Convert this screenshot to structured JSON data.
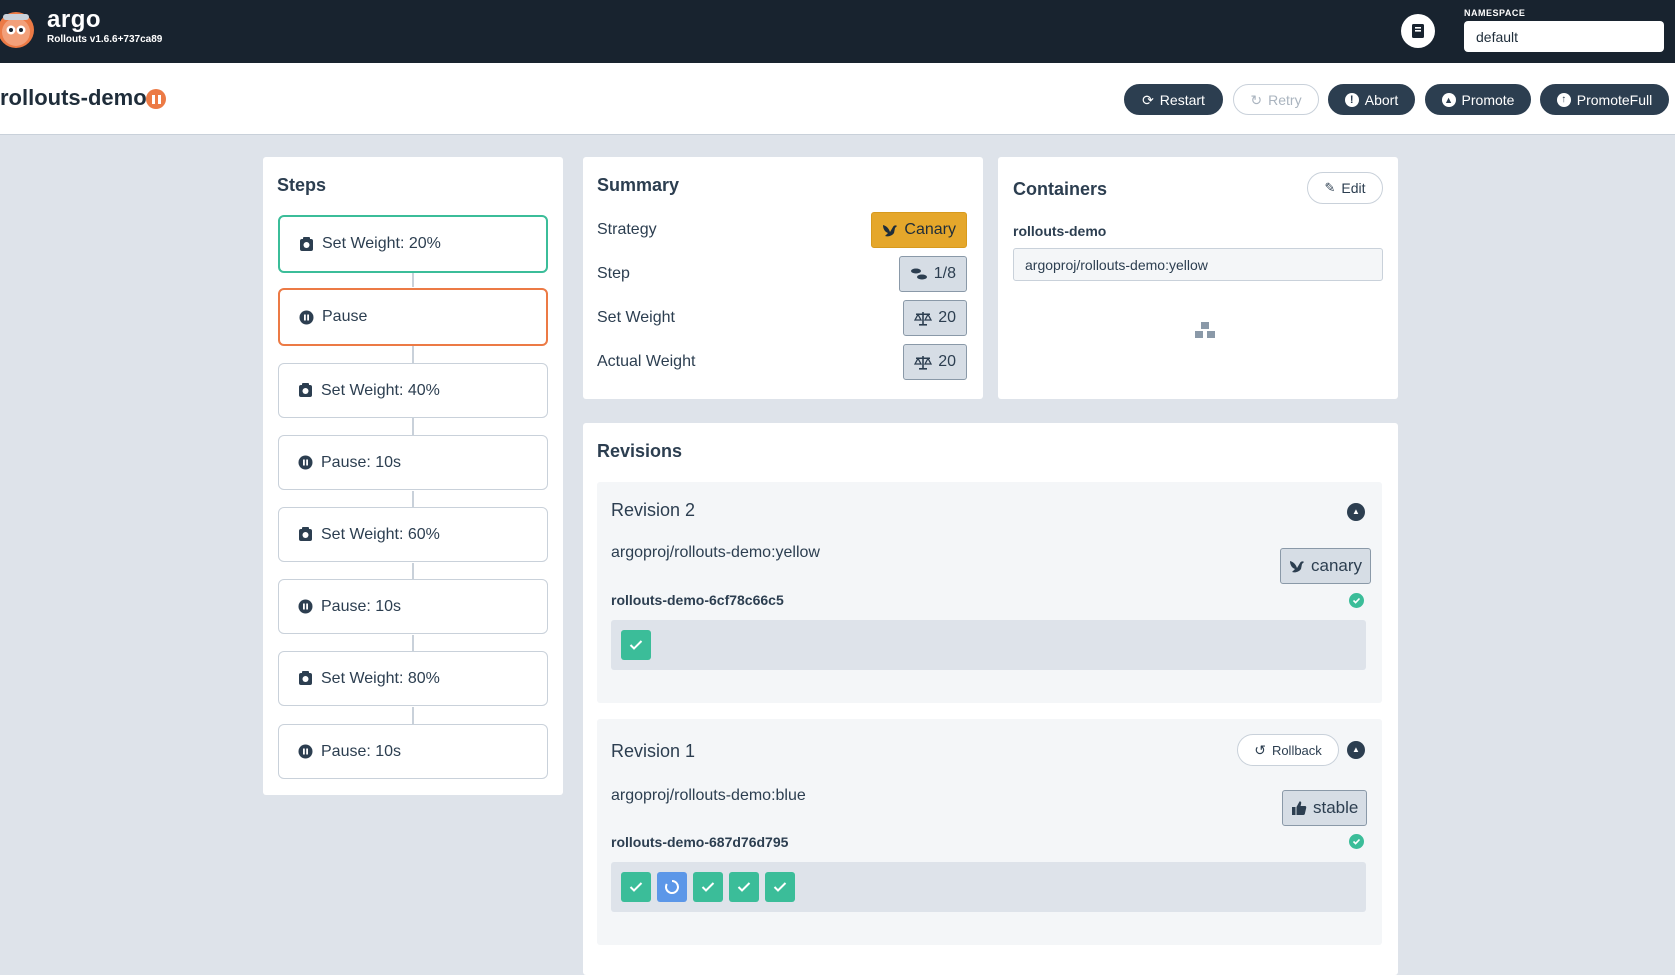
{
  "topbar": {
    "brand": "argo",
    "version": "Rollouts v1.6.6+737ca89",
    "namespace_label": "NAMESPACE",
    "namespace_value": "default"
  },
  "header": {
    "title": "rollouts-demo",
    "status": "paused",
    "buttons": {
      "restart": "Restart",
      "retry": "Retry",
      "abort": "Abort",
      "promote": "Promote",
      "promote_full": "PromoteFull"
    }
  },
  "steps": {
    "title": "Steps",
    "items": [
      {
        "label": "Set Weight: 20%",
        "icon": "weight-icon",
        "state": "current"
      },
      {
        "label": "Pause",
        "icon": "pause-icon",
        "state": "paused"
      },
      {
        "label": "Set Weight: 40%",
        "icon": "weight-icon",
        "state": "pending"
      },
      {
        "label": "Pause: 10s",
        "icon": "pause-icon",
        "state": "pending"
      },
      {
        "label": "Set Weight: 60%",
        "icon": "weight-icon",
        "state": "pending"
      },
      {
        "label": "Pause: 10s",
        "icon": "pause-icon",
        "state": "pending"
      },
      {
        "label": "Set Weight: 80%",
        "icon": "weight-icon",
        "state": "pending"
      },
      {
        "label": "Pause: 10s",
        "icon": "pause-icon",
        "state": "pending"
      }
    ]
  },
  "summary": {
    "title": "Summary",
    "rows": [
      {
        "label": "Strategy",
        "value": "Canary",
        "icon": "canary-bird-icon"
      },
      {
        "label": "Step",
        "value": "1/8",
        "icon": "shoe-prints-icon"
      },
      {
        "label": "Set Weight",
        "value": "20",
        "icon": "balance-scale-icon"
      },
      {
        "label": "Actual Weight",
        "value": "20",
        "icon": "balance-scale-icon"
      }
    ]
  },
  "containers": {
    "title": "Containers",
    "edit_label": "Edit",
    "name": "rollouts-demo",
    "image": "argoproj/rollouts-demo:yellow"
  },
  "revisions": {
    "title": "Revisions",
    "items": [
      {
        "title": "Revision 2",
        "image": "argoproj/rollouts-demo:yellow",
        "tag": "canary",
        "replicaset": "rollouts-demo-6cf78c66c5",
        "pods": [
          "ok"
        ]
      },
      {
        "title": "Revision 1",
        "image": "argoproj/rollouts-demo:blue",
        "tag": "stable",
        "rollback_label": "Rollback",
        "replicaset": "rollouts-demo-687d76d795",
        "pods": [
          "ok",
          "progress",
          "ok",
          "ok",
          "ok"
        ]
      }
    ]
  },
  "colors": {
    "topbar": "#18232f",
    "accent_green": "#3bbd99",
    "accent_orange": "#ec7a45",
    "canary_yellow": "#e5a72b",
    "progress_blue": "#5c97e8"
  }
}
